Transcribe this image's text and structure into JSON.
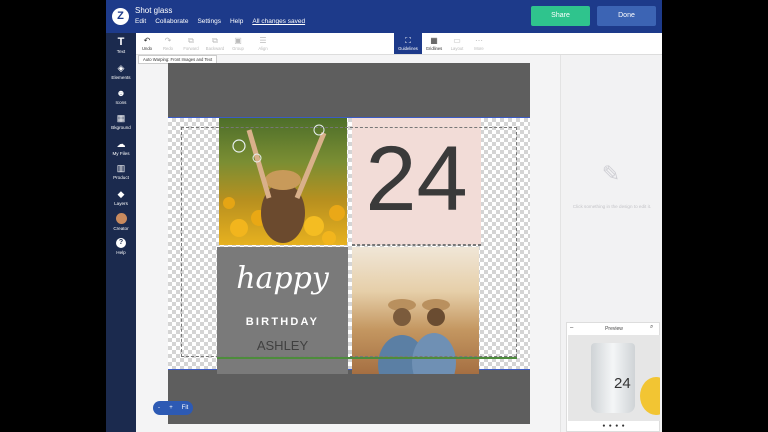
{
  "header": {
    "logo": "Z",
    "title": "Shot glass",
    "menu": [
      "Edit",
      "Collaborate",
      "Settings",
      "Help"
    ],
    "saved_label": "All changes saved",
    "share_label": "Share",
    "done_label": "Done",
    "colors": {
      "header": "#1d3a8a",
      "share": "#2fc48d",
      "done": "#3c64b4"
    }
  },
  "sidebar": {
    "items": [
      {
        "label": "Text",
        "icon": "text-icon"
      },
      {
        "label": "Elements",
        "icon": "elements-icon"
      },
      {
        "label": "Icons",
        "icon": "smiley-icon"
      },
      {
        "label": "Bkground",
        "icon": "background-icon"
      },
      {
        "label": "My Files",
        "icon": "cloud-upload-icon"
      },
      {
        "label": "Product",
        "icon": "product-icon"
      },
      {
        "label": "Layers",
        "icon": "layers-icon"
      },
      {
        "label": "Creator",
        "icon": "creator-avatar"
      },
      {
        "label": "Help",
        "icon": "help-icon"
      }
    ]
  },
  "toolbar": {
    "items": [
      {
        "label": "Undo",
        "enabled": true
      },
      {
        "label": "Redo",
        "enabled": false
      },
      {
        "label": "Forward",
        "enabled": false
      },
      {
        "label": "Backward",
        "enabled": false
      },
      {
        "label": "Group",
        "enabled": false
      },
      {
        "label": "Align",
        "enabled": false
      },
      {
        "label": "Guidelines",
        "enabled": true,
        "active": true
      },
      {
        "label": "Gridlines",
        "enabled": true
      },
      {
        "label": "Layout",
        "enabled": false
      },
      {
        "label": "More",
        "enabled": false
      }
    ]
  },
  "warning_chip": "Auto Warping: Front Images and Text",
  "design": {
    "number": "24",
    "happy": "happy",
    "birthday": "BIRTHDAY",
    "name": "ASHLEY"
  },
  "right_panel": {
    "hint": "Click something in the design to edit it."
  },
  "zoom": {
    "minus": "-",
    "plus": "+",
    "fit": "Fit"
  },
  "preview": {
    "title": "Preview",
    "mock_number": "24",
    "dots": "● ● ● ●"
  }
}
